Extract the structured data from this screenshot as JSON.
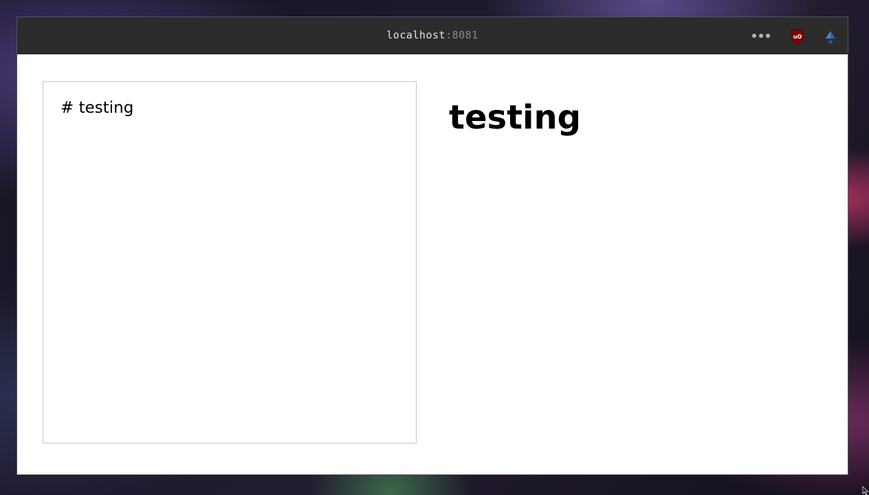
{
  "browser": {
    "url_host": "localhost",
    "url_port": ":8081",
    "menu_icon": "more-horizontal-icon",
    "extensions": [
      {
        "icon": "ublock-origin-shield-icon",
        "label": "uO",
        "color": "#800000"
      },
      {
        "icon": "triangle-extension-icon",
        "color": "#2f6fbf"
      }
    ]
  },
  "editor": {
    "text": "# testing"
  },
  "preview": {
    "heading": "testing"
  }
}
